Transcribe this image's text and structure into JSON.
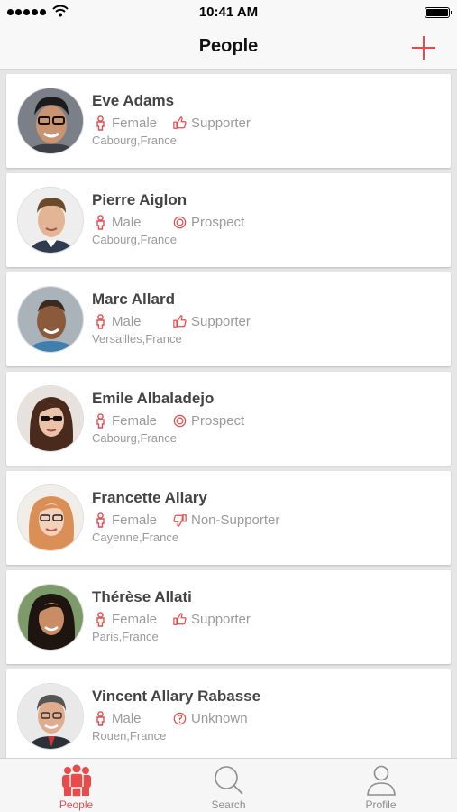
{
  "status_bar": {
    "time": "10:41 AM"
  },
  "nav": {
    "title": "People"
  },
  "icons": {
    "add": "plus-icon",
    "gender": "person-icon",
    "supporter": "thumbs-up-icon",
    "non_supporter": "thumbs-down-icon",
    "prospect": "target-icon",
    "unknown": "question-circle-icon"
  },
  "colors": {
    "accent": "#e94b4b",
    "muted_text": "#9a9a9a",
    "name_text": "#444444"
  },
  "people": [
    {
      "name": "Eve Adams",
      "gender": "Female",
      "status": "Supporter",
      "location": "Cabourg,France"
    },
    {
      "name": "Pierre Aiglon",
      "gender": "Male",
      "status": "Prospect",
      "location": "Cabourg,France"
    },
    {
      "name": "Marc Allard",
      "gender": "Male",
      "status": "Supporter",
      "location": "Versailles,France"
    },
    {
      "name": "Emile Albaladejo",
      "gender": "Female",
      "status": "Prospect",
      "location": "Cabourg,France"
    },
    {
      "name": "Francette Allary",
      "gender": "Female",
      "status": "Non-Supporter",
      "location": "Cayenne,France"
    },
    {
      "name": "Thérèse Allati",
      "gender": "Female",
      "status": "Supporter",
      "location": "Paris,France"
    },
    {
      "name": "Vincent Allary Rabasse",
      "gender": "Male",
      "status": "Unknown",
      "location": "Rouen,France"
    }
  ],
  "tabs": [
    {
      "label": "People",
      "active": true
    },
    {
      "label": "Search",
      "active": false
    },
    {
      "label": "Profile",
      "active": false
    }
  ]
}
